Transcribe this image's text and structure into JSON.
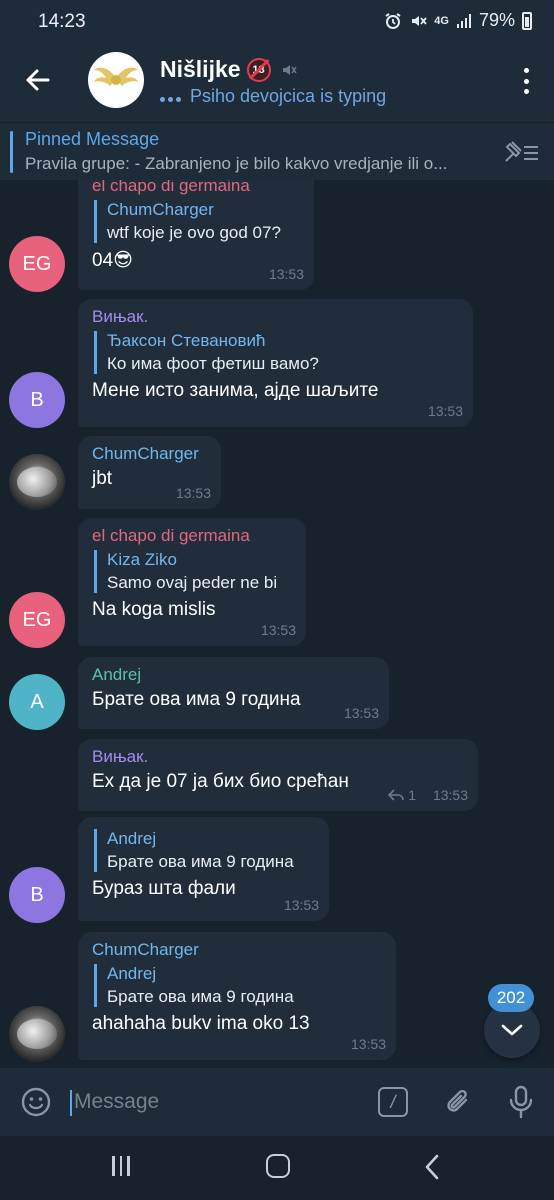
{
  "status": {
    "time": "14:23",
    "battery": "79%",
    "network": "4G"
  },
  "header": {
    "title": "Nišlijke",
    "typing": "Psiho devojcica is typing",
    "logo_text": "Niš lijke"
  },
  "pinned": {
    "title": "Pinned Message",
    "text": "Pravila grupe:  - Zabranjeno je bilo kakvo vredjanje ili o..."
  },
  "colors": {
    "accent": "#5ea7e8",
    "avatar_pink": "#e8627d",
    "avatar_purple": "#8d76e0",
    "avatar_teal": "#4fb4c8"
  },
  "messages": [
    {
      "sender": "el chapo di germaina",
      "reply_name": "ChumCharger",
      "reply_text": "wtf koje je ovo god 07?",
      "text": "04😎",
      "time": "13:53"
    },
    {
      "sender": "Вињак.",
      "reply_name": "Ђаксон Стевановић",
      "reply_text": "Ко има фоот фетиш вамо?",
      "text": "Мене исто занима, ајде шаљите",
      "time": "13:53",
      "avatar": "B"
    },
    {
      "sender": "ChumCharger",
      "text": "jbt",
      "time": "13:53"
    },
    {
      "sender": "el chapo di germaina",
      "reply_name": "Kiza Ziko",
      "reply_text": "Samo ovaj peder ne bi",
      "text": "Na koga mislis",
      "time": "13:53",
      "avatar": "EG"
    },
    {
      "sender": "Andrej",
      "text": "Брате ова има 9 година",
      "time": "13:53",
      "avatar": "A"
    },
    {
      "sender": "Вињак.",
      "text": "Ех да је 07 ја бих био срећан",
      "time": "13:53",
      "replies": "1"
    },
    {
      "reply_name": "Andrej",
      "reply_text": "Брате ова има 9 година",
      "text": "Бураз шта фали",
      "time": "13:53",
      "avatar": "B"
    },
    {
      "sender": "ChumCharger",
      "reply_name": "Andrej",
      "reply_text": "Брате ова има 9 година",
      "text": "ahahaha bukv ima oko 13",
      "time": "13:53"
    }
  ],
  "avatars": {
    "eg": "EG"
  },
  "unread_count": "202",
  "input": {
    "placeholder": "Message"
  }
}
